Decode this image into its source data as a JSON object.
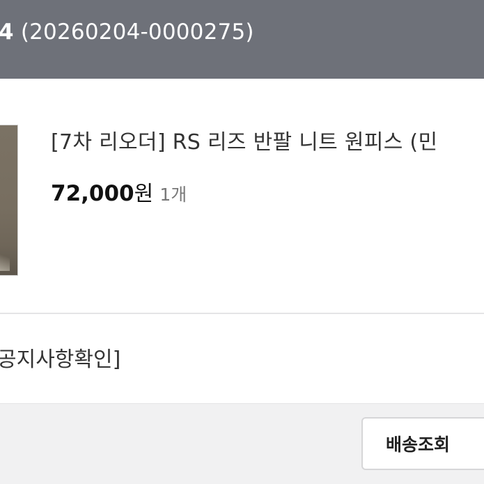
{
  "order": {
    "number_prefix": "4",
    "number": "(20260204-0000275)"
  },
  "product": {
    "name": "[7차 리오더] RS 리즈 반팔 니트 원피스 (민",
    "price": "72,000",
    "currency": "원",
    "quantity": "1개"
  },
  "notice": {
    "text": "공지사항확인]"
  },
  "actions": {
    "track_label": "배송조회"
  },
  "colors": {
    "header_bg": "#6e7179",
    "page_bg": "#f1f1f2",
    "card_bg": "#ffffff"
  }
}
